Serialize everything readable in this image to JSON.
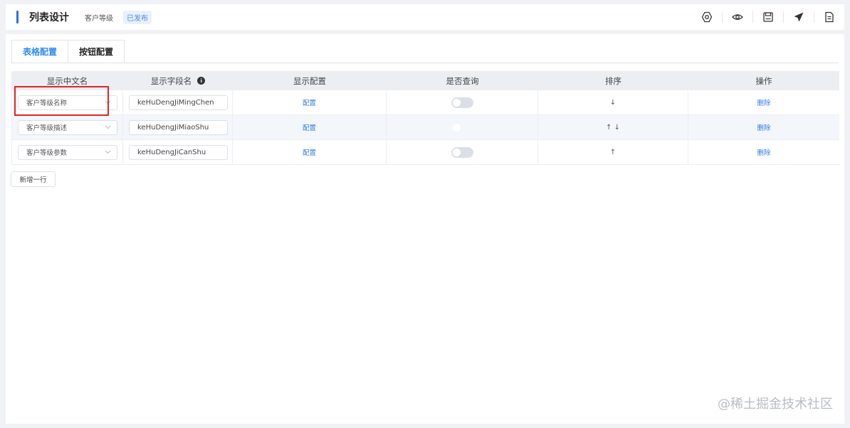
{
  "header": {
    "title": "列表设计",
    "subtitle": "客户等级",
    "status": "已发布",
    "tools": [
      "settings-icon",
      "eye-icon",
      "save-icon",
      "send-icon",
      "document-icon"
    ]
  },
  "tabs": [
    {
      "label": "表格配置",
      "active": true
    },
    {
      "label": "按钮配置",
      "active": false
    }
  ],
  "table": {
    "columns": [
      "显示中文名",
      "显示字段名",
      "显示配置",
      "是否查询",
      "排序",
      "操作"
    ],
    "rows": [
      {
        "cn_name": "客户等级名称",
        "field": "keHuDengJiMingChen",
        "config": "配置",
        "query": false,
        "sort": "↓",
        "action": "删除"
      },
      {
        "cn_name": "客户等级描述",
        "field": "keHuDengJiMiaoShu",
        "config": "配置",
        "query": false,
        "sort": "↑ ↓",
        "action": "删除"
      },
      {
        "cn_name": "客户等级参数",
        "field": "keHuDengJiCanShu",
        "config": "配置",
        "query": false,
        "sort": "↑",
        "action": "删除"
      }
    ]
  },
  "add_row_label": "新增一行",
  "watermark": "@稀土掘金技术社区",
  "colors": {
    "accent": "#2f6fe4",
    "link": "#2f7ce5",
    "highlight": "#e02424"
  }
}
